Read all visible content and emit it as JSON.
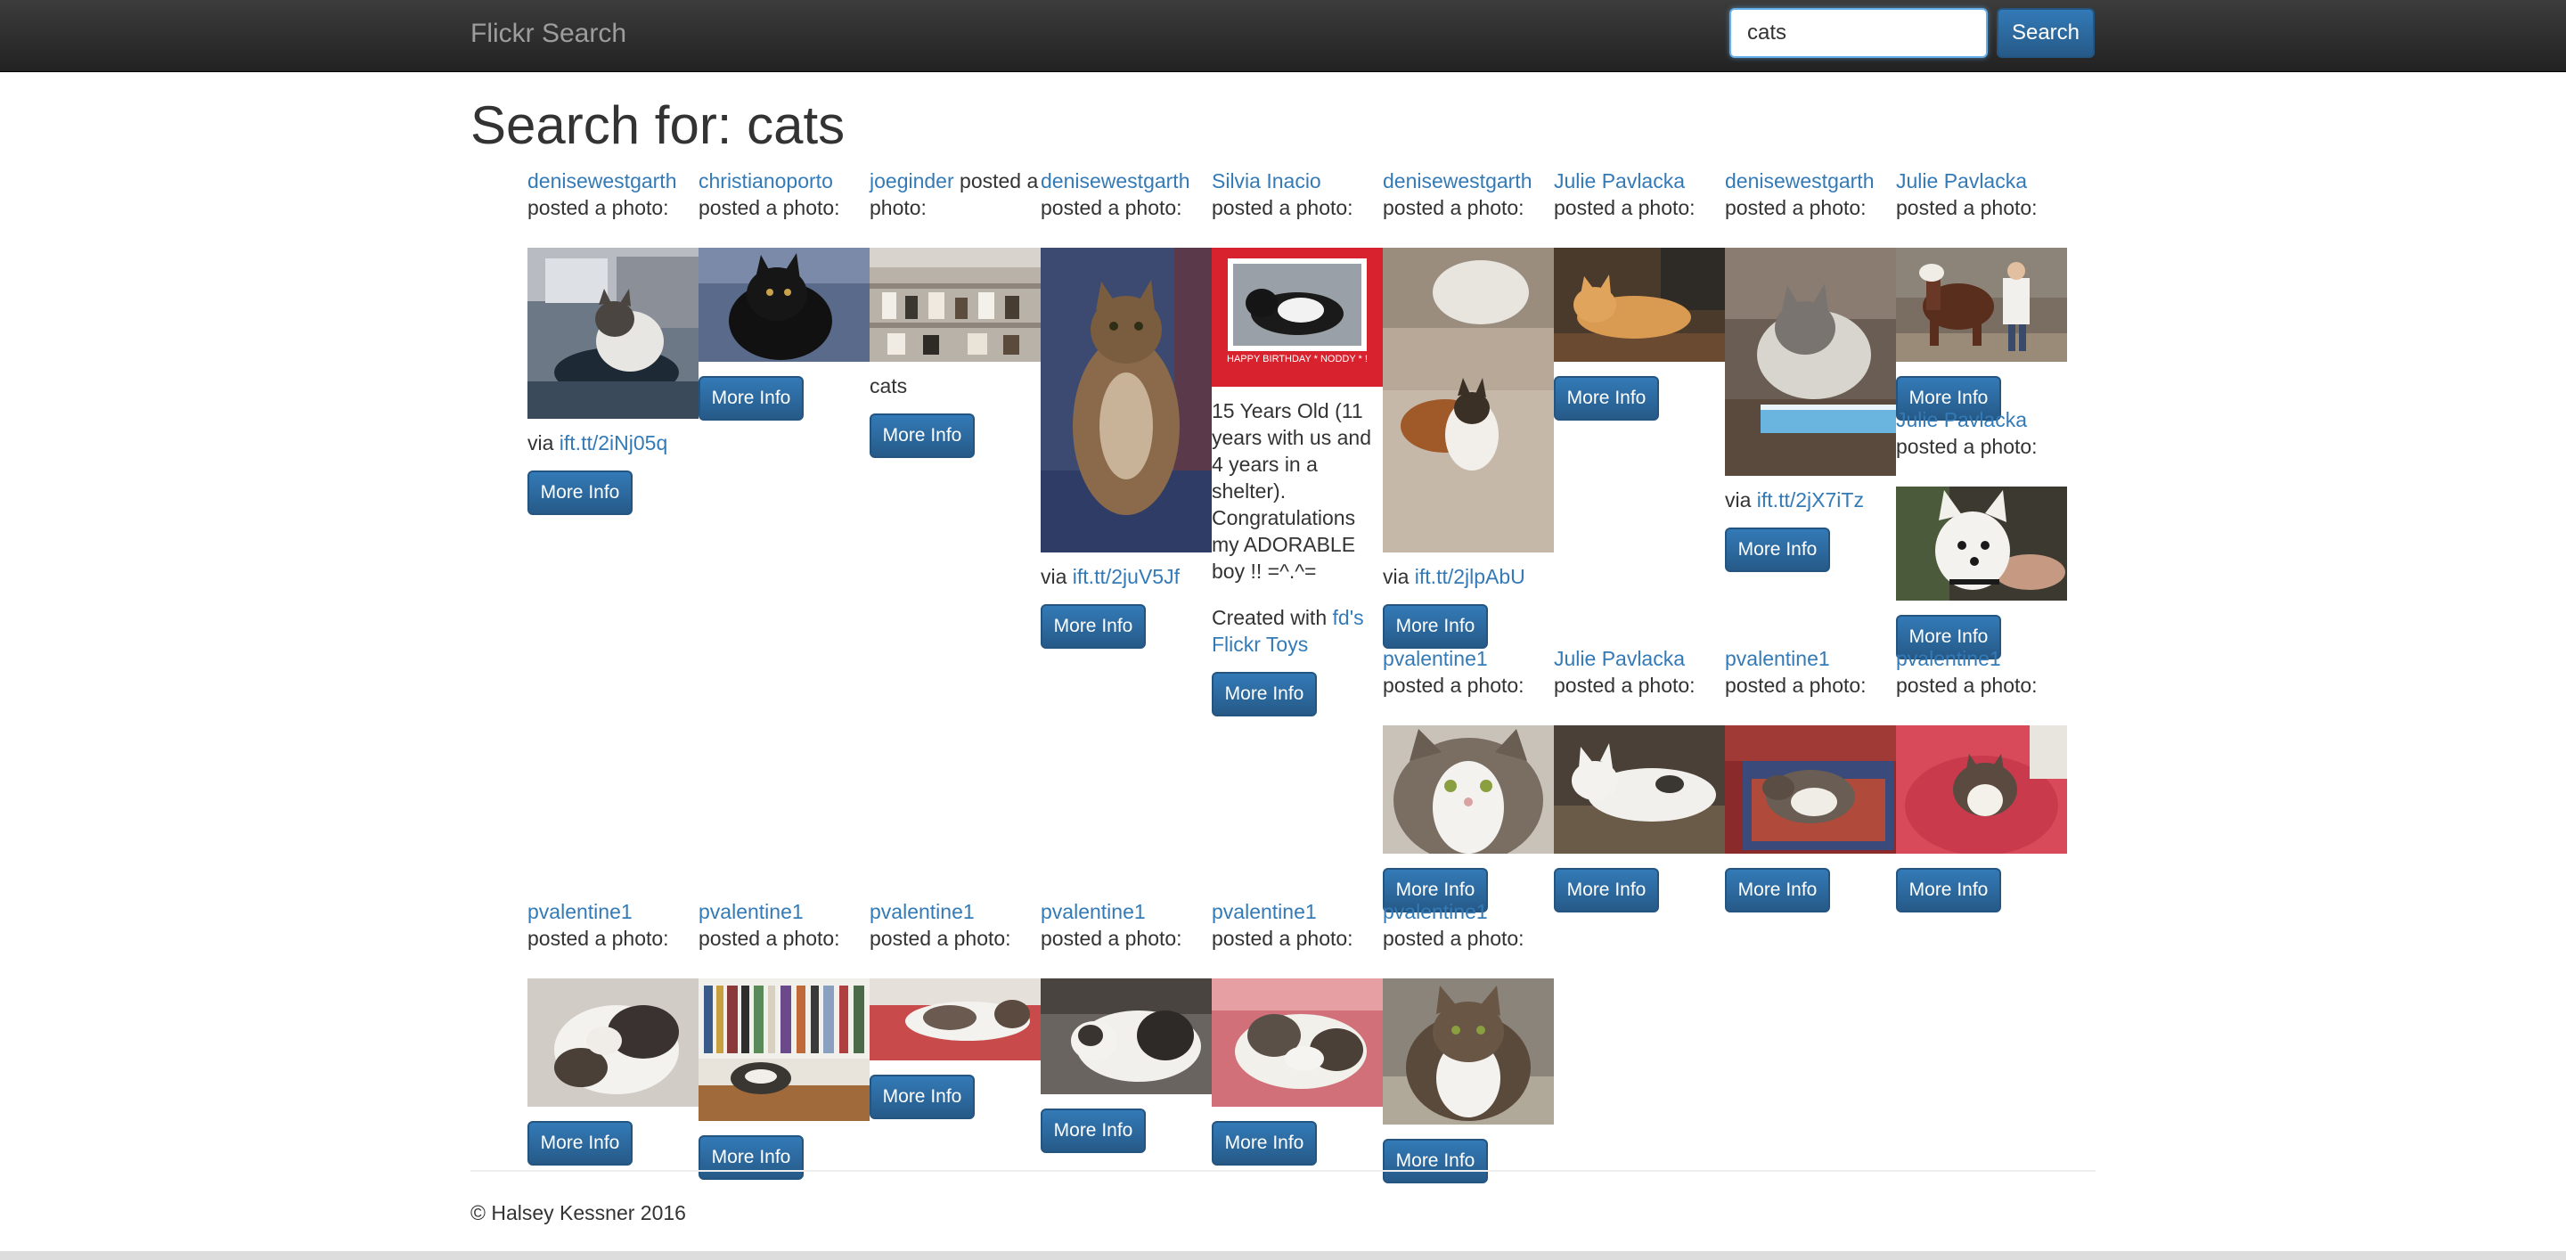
{
  "navbar": {
    "brand": "Flickr Search",
    "search_value": "cats",
    "search_button": "Search"
  },
  "page": {
    "title": "Search for: cats",
    "posted_text": "posted a photo:",
    "more_info": "More Info",
    "via_text": "via"
  },
  "footer": {
    "copyright": "© Halsey Kessner 2016"
  },
  "results": [
    {
      "author": "denisewestgarth",
      "via_link": "ift.tt/2iNj05q"
    },
    {
      "author": "christianoporto"
    },
    {
      "author": "joeginder",
      "desc": "cats"
    },
    {
      "author": "denisewestgarth",
      "via_link": "ift.tt/2juV5Jf"
    },
    {
      "author": "Silvia Inacio",
      "photo_caption": "HAPPY BIRTHDAY * NODDY * !",
      "desc": "15 Years Old (11 years with us and 4 years in a shelter). Congratulations my ADORABLE boy !! =^.^=",
      "created_prefix": "Created with",
      "created_link": "fd's Flickr Toys"
    },
    {
      "author": "denisewestgarth",
      "via_link": "ift.tt/2jlpAbU"
    },
    {
      "author": "Julie Pavlacka"
    },
    {
      "author": "denisewestgarth",
      "via_link": "ift.tt/2jX7iTz"
    },
    {
      "author": "Julie Pavlacka"
    },
    {
      "author": "Julie Pavlacka"
    },
    {
      "author": "pvalentine1"
    },
    {
      "author": "Julie Pavlacka"
    },
    {
      "author": "pvalentine1"
    },
    {
      "author": "pvalentine1"
    },
    {
      "author": "pvalentine1"
    },
    {
      "author": "pvalentine1"
    },
    {
      "author": "pvalentine1"
    },
    {
      "author": "pvalentine1"
    },
    {
      "author": "pvalentine1"
    },
    {
      "author": "pvalentine1"
    }
  ]
}
